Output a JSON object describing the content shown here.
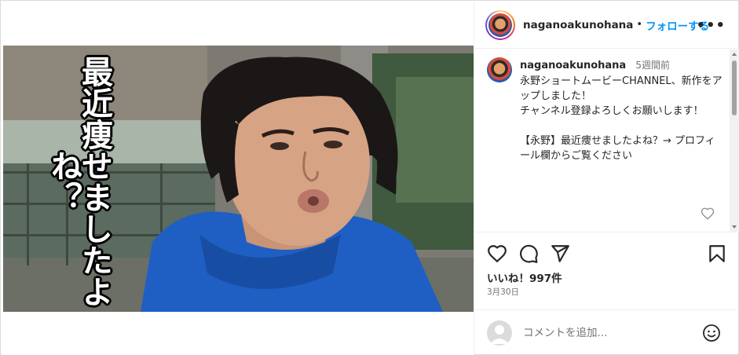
{
  "post": {
    "caption_overlay": "最近痩せましたよね？"
  },
  "header": {
    "username": "naganoakunohana",
    "separator": "•",
    "follow_label": "フォローする",
    "more_label": "•••"
  },
  "comment": {
    "username": "naganoakunohana",
    "time": "5週間前",
    "text": "永野ショートムービーCHANNEL、新作をアップしました！\nチャンネル登録よろしくお願いします！\n\n【永野】最近痩せましたよね？→ プロフィール欄からご覧ください"
  },
  "actions": {
    "likes": "いいね！997件",
    "date": "3月30日"
  },
  "add_comment": {
    "placeholder": "コメントを追加..."
  },
  "icons": {
    "more": "more-icon",
    "like": "heart-icon",
    "comment": "comment-icon",
    "share": "send-icon",
    "save": "bookmark-icon",
    "emoji": "emoji-icon"
  },
  "colors": {
    "link": "#0095f6",
    "text": "#262626",
    "secondary": "#737373",
    "border": "#dbdbdb",
    "hoodie": "#1f5fc4"
  }
}
